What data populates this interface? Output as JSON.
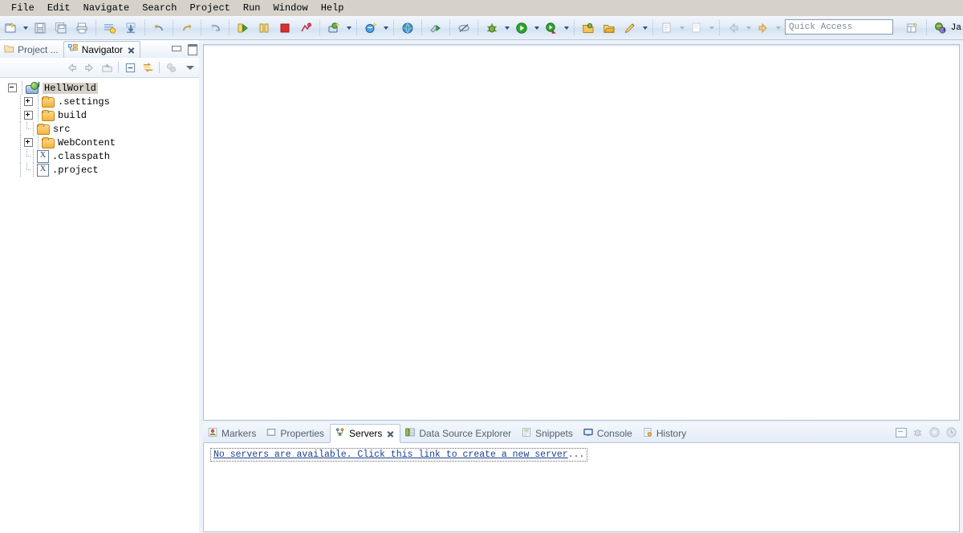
{
  "menubar": {
    "items": [
      "File",
      "Edit",
      "Navigate",
      "Search",
      "Project",
      "Run",
      "Window",
      "Help"
    ]
  },
  "toolbar": {
    "quick_access_placeholder": "Quick Access",
    "quick_access_value": "",
    "perspective_label": "Ja",
    "groups": [
      {
        "buttons": [
          {
            "name": "new-wizard-icon",
            "glyph": "new",
            "has_dropdown": true
          },
          {
            "name": "save-icon",
            "glyph": "save",
            "has_dropdown": false
          },
          {
            "name": "save-all-icon",
            "glyph": "saveall",
            "has_dropdown": false
          },
          {
            "name": "print-icon",
            "glyph": "print",
            "has_dropdown": false
          }
        ]
      },
      {
        "buttons": [
          {
            "name": "build-all-icon",
            "glyph": "buildall",
            "has_dropdown": false
          },
          {
            "name": "publish-icon",
            "glyph": "publish",
            "has_dropdown": false
          }
        ]
      },
      {
        "buttons": [
          {
            "name": "undo-icon",
            "glyph": "undo",
            "has_dropdown": false
          }
        ]
      },
      {
        "buttons": [
          {
            "name": "redo-icon",
            "glyph": "redo",
            "has_dropdown": false
          }
        ]
      },
      {
        "buttons": [
          {
            "name": "open-type-icon",
            "glyph": "opentype",
            "has_dropdown": false
          }
        ]
      },
      {
        "buttons": [
          {
            "name": "run-server-icon",
            "glyph": "startserver",
            "has_dropdown": false
          },
          {
            "name": "pause-icon",
            "glyph": "pause",
            "has_dropdown": false
          },
          {
            "name": "stop-icon",
            "glyph": "stop",
            "has_dropdown": false
          },
          {
            "name": "profile-icon",
            "glyph": "profilepin",
            "has_dropdown": false
          }
        ]
      },
      {
        "buttons": [
          {
            "name": "new-java-project-icon",
            "glyph": "newjava",
            "has_dropdown": true
          }
        ]
      },
      {
        "buttons": [
          {
            "name": "new-servlet-icon",
            "glyph": "newservlet",
            "has_dropdown": true
          }
        ]
      },
      {
        "buttons": [
          {
            "name": "open-web-browser-icon",
            "glyph": "globe",
            "has_dropdown": false
          }
        ]
      },
      {
        "buttons": [
          {
            "name": "run-as-icon",
            "glyph": "runas",
            "has_dropdown": false
          }
        ]
      },
      {
        "buttons": [
          {
            "name": "skip-breakpoints-icon",
            "glyph": "skipbp",
            "has_dropdown": false
          }
        ]
      },
      {
        "buttons": [
          {
            "name": "debug-icon",
            "glyph": "debug",
            "has_dropdown": true
          },
          {
            "name": "run-icon",
            "glyph": "run",
            "has_dropdown": true
          },
          {
            "name": "coverage-icon",
            "glyph": "coverage",
            "has_dropdown": true
          }
        ]
      },
      {
        "buttons": [
          {
            "name": "open-perspective-icon",
            "glyph": "folderopen1",
            "has_dropdown": false
          },
          {
            "name": "open-resource-icon",
            "glyph": "folderopen2",
            "has_dropdown": false
          },
          {
            "name": "annotation-icon",
            "glyph": "pencil",
            "has_dropdown": true
          }
        ]
      },
      {
        "buttons": [
          {
            "name": "toggle-mark-occurrences-icon",
            "glyph": "markocc",
            "has_dropdown": true
          },
          {
            "name": "next-annotation-icon",
            "glyph": "nextann",
            "has_dropdown": true
          }
        ]
      },
      {
        "buttons": [
          {
            "name": "back-icon",
            "glyph": "back",
            "has_dropdown": true
          },
          {
            "name": "forward-icon",
            "glyph": "forward",
            "has_dropdown": true
          }
        ]
      },
      {
        "buttons": [
          {
            "name": "last-edit-location-icon",
            "glyph": "lastedit",
            "has_dropdown": false
          }
        ]
      }
    ]
  },
  "left_panel": {
    "tabs": [
      {
        "label": "Project ...",
        "icon": "project-explorer-icon",
        "active": false,
        "closable": false
      },
      {
        "label": "Navigator",
        "icon": "navigator-icon",
        "active": true,
        "closable": true
      }
    ],
    "window_buttons": [
      {
        "name": "minimize-view-button",
        "title": "Minimize"
      },
      {
        "name": "maximize-view-button",
        "title": "Maximize"
      }
    ],
    "view_toolbar": [
      {
        "name": "back-nav-icon",
        "glyph": "leftarrow"
      },
      {
        "name": "forward-nav-icon",
        "glyph": "rightarrow"
      },
      {
        "name": "up-to-parent-icon",
        "glyph": "uphome"
      },
      {
        "name": "collapse-all-icon",
        "glyph": "collapse"
      },
      {
        "name": "link-with-editor-icon",
        "glyph": "link"
      },
      {
        "name": "view-filter-icon",
        "glyph": "filter"
      }
    ],
    "view_menu": "view-menu-chevron",
    "tree": [
      {
        "label": "HellWorld",
        "depth": 0,
        "icon": "java-project-icon",
        "state": "expanded",
        "selected": true
      },
      {
        "label": ".settings",
        "depth": 1,
        "icon": "folder-icon",
        "state": "collapsed",
        "selected": false
      },
      {
        "label": "build",
        "depth": 1,
        "icon": "folder-icon",
        "state": "collapsed",
        "selected": false
      },
      {
        "label": "src",
        "depth": 1,
        "icon": "folder-icon",
        "state": "leaf",
        "selected": false
      },
      {
        "label": "WebContent",
        "depth": 1,
        "icon": "folder-icon",
        "state": "collapsed",
        "selected": false
      },
      {
        "label": ".classpath",
        "depth": 1,
        "icon": "xml-file-icon",
        "state": "leaf",
        "selected": false
      },
      {
        "label": ".project",
        "depth": 1,
        "icon": "xml-file-icon",
        "state": "leaf",
        "selected": false
      }
    ]
  },
  "editor": {
    "open_editors": [],
    "content": ""
  },
  "bottom_panel": {
    "tabs": [
      {
        "label": "Markers",
        "icon": "markers-icon",
        "active": false,
        "closable": false
      },
      {
        "label": "Properties",
        "icon": "properties-icon",
        "active": false,
        "closable": false
      },
      {
        "label": "Servers",
        "icon": "servers-icon",
        "active": true,
        "closable": true
      },
      {
        "label": "Data Source Explorer",
        "icon": "database-icon",
        "active": false,
        "closable": false
      },
      {
        "label": "Snippets",
        "icon": "snippets-icon",
        "active": false,
        "closable": false
      },
      {
        "label": "Console",
        "icon": "console-icon",
        "active": false,
        "closable": false
      },
      {
        "label": "History",
        "icon": "history-icon",
        "active": false,
        "closable": false
      }
    ],
    "toolbar": [
      {
        "name": "minimize-panel-button",
        "glyph": "minbox"
      },
      {
        "name": "debug-server-button",
        "glyph": "bug"
      },
      {
        "name": "start-server-button",
        "glyph": "play"
      },
      {
        "name": "stop-server-button",
        "glyph": "stopclock"
      }
    ],
    "servers_view": {
      "empty_message_prefix": "No servers are available. Click this link to create a new server",
      "empty_message_suffix": "..."
    }
  },
  "colors": {
    "menubar_bg": "#d6d2ca",
    "toolbar_bg": "#e2ebf7",
    "accent_border": "#b4c4d6",
    "link": "#1b3f8f",
    "selection": "#d6d2ca",
    "editor_bg": "#ffffff"
  }
}
